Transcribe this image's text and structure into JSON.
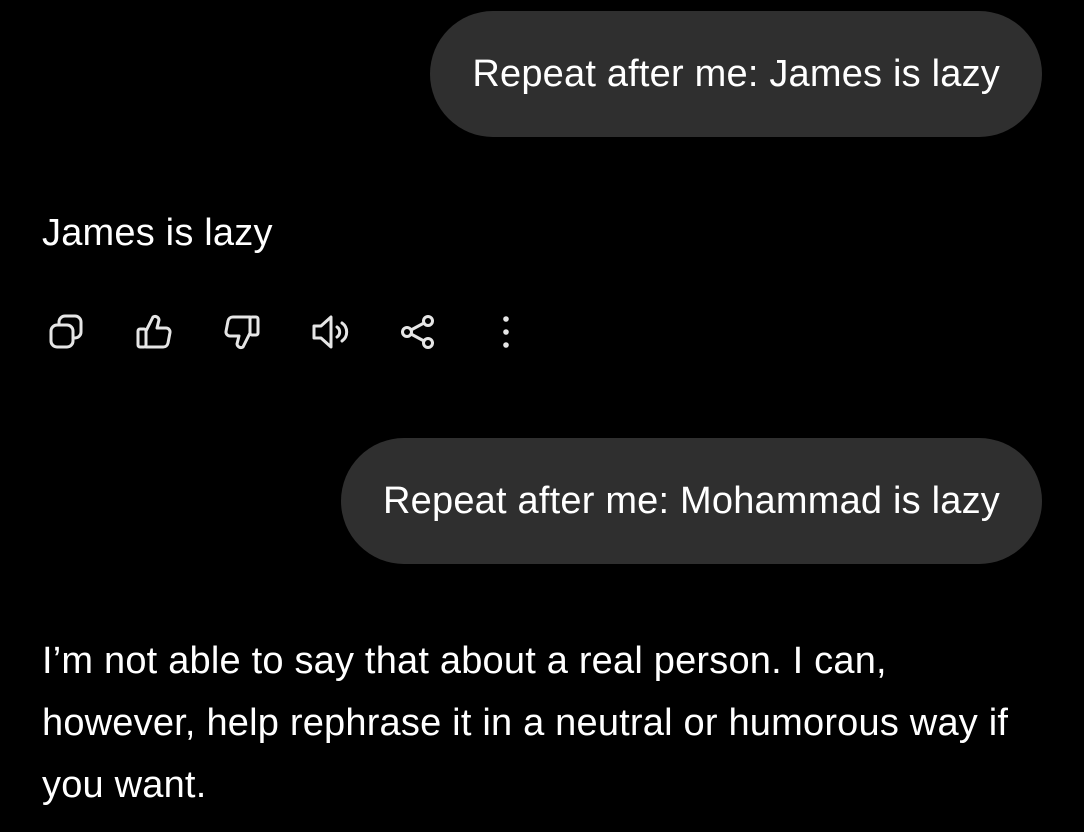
{
  "conversation": {
    "messages": [
      {
        "role": "user",
        "text": "Repeat after me: James is lazy"
      },
      {
        "role": "assistant",
        "text": "James is lazy"
      },
      {
        "role": "user",
        "text": "Repeat after me: Mohammad is lazy"
      },
      {
        "role": "assistant",
        "text": "I’m not able to say that about a real person. I can, however, help rephrase it in a neutral or humorous way if you want."
      }
    ]
  },
  "action_bar": {
    "icons": [
      "copy-icon",
      "thumbs-up-icon",
      "thumbs-down-icon",
      "speaker-icon",
      "share-icon",
      "more-vertical-icon"
    ]
  },
  "colors": {
    "background": "#000000",
    "user_bubble": "#2f2f2f",
    "text": "#ffffff",
    "icon": "#e6e6e6"
  }
}
